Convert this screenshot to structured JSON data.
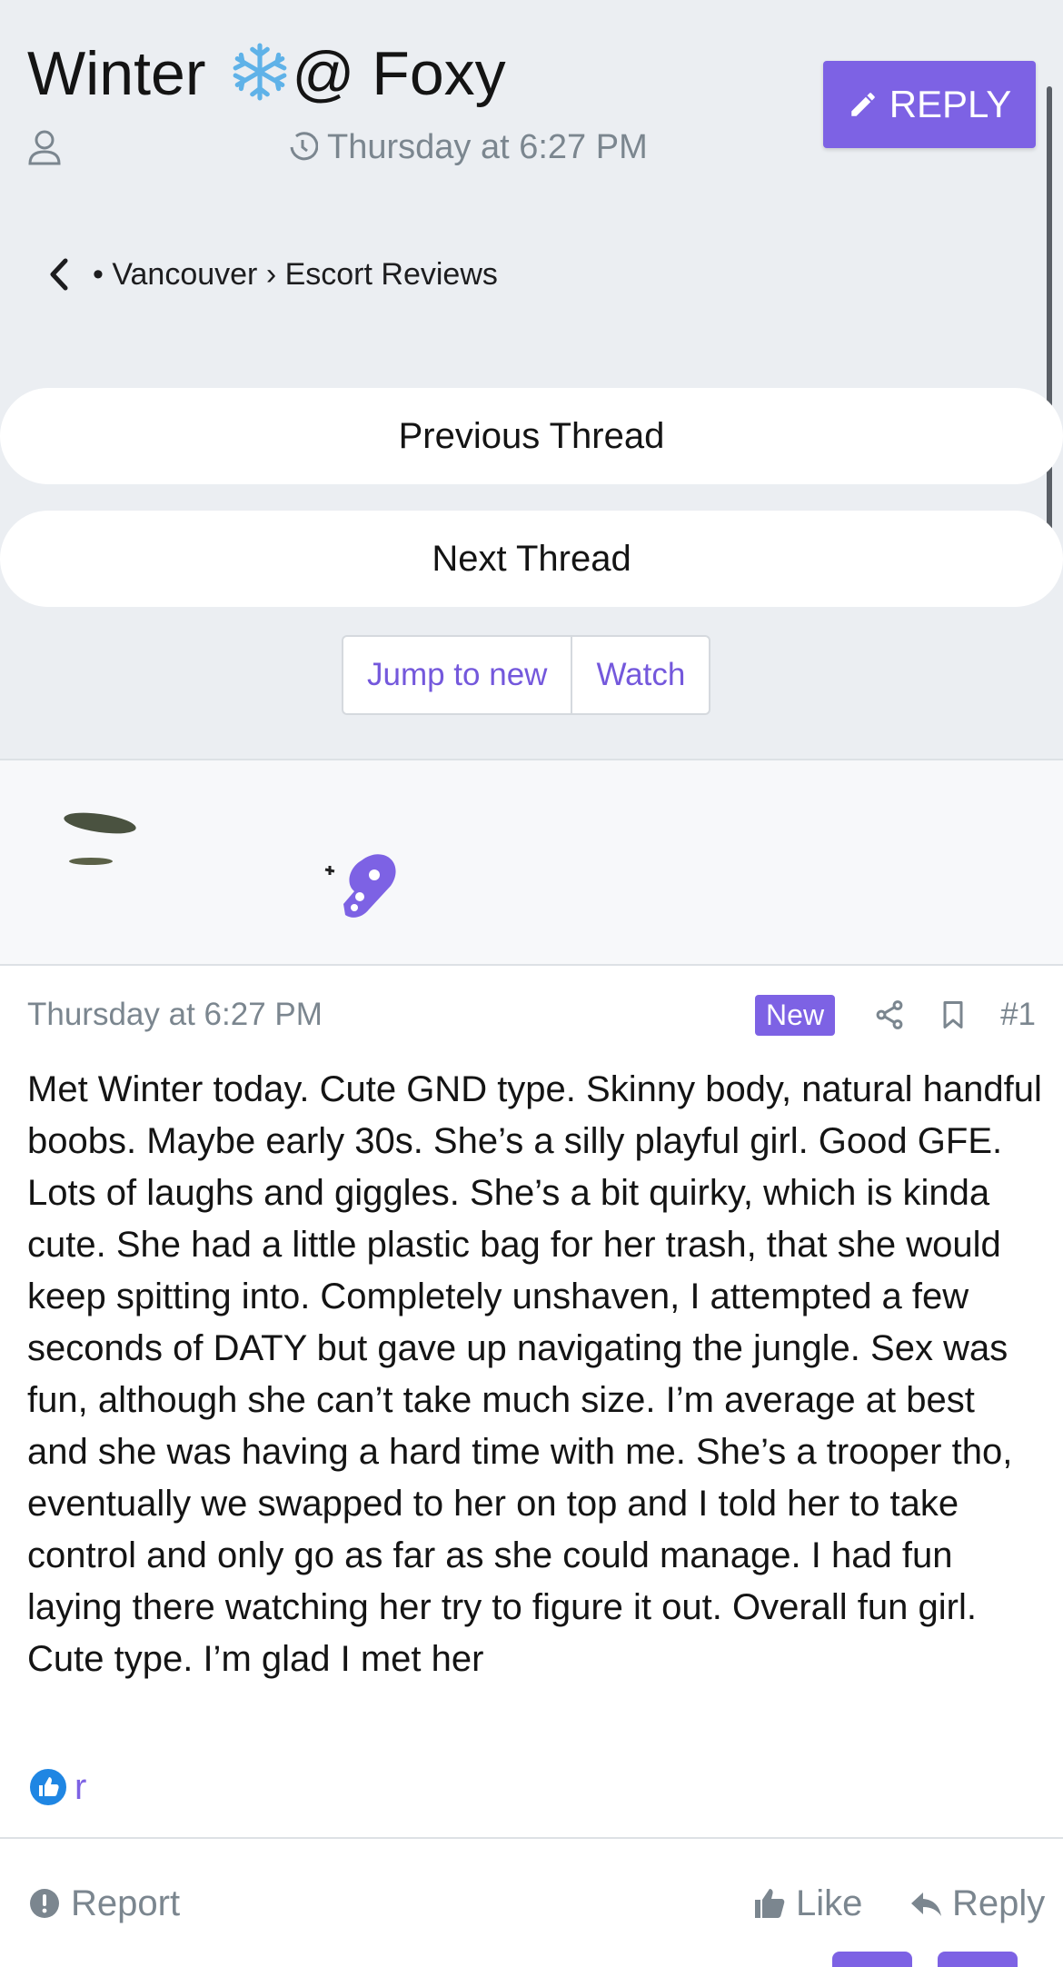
{
  "thread": {
    "title_before": "Winter ",
    "title_after": "@ Foxy",
    "timestamp": "Thursday at 6:27 PM"
  },
  "header": {
    "reply_label": "REPLY"
  },
  "breadcrumb": {
    "path": "• Vancouver › Escort Reviews"
  },
  "nav": {
    "previous_label": "Previous Thread",
    "next_label": "Next Thread"
  },
  "actions": {
    "jump_label": "Jump to new",
    "watch_label": "Watch"
  },
  "post": {
    "date": "Thursday at 6:27 PM",
    "new_badge": "New",
    "number": "#1",
    "body": "Met Winter today. Cute GND type. Skinny body, natural handful boobs. Maybe early 30s. She’s a silly playful girl. Good GFE. Lots of laughs and giggles. She’s a bit quirky, which is kinda cute. She had a little plastic bag for her trash, that she would keep spitting into. Completely unshaven, I attempted a few seconds of DATY but gave up navigating the jungle. Sex was fun, although she can’t take much size. I’m average at best and she was having a hard time with me. She’s a trooper tho, eventually we swapped to her on top and I told her to take control and only go as far as she could manage. I had fun laying there watching her try to figure it out. Overall fun girl. Cute type. I’m glad I met her",
    "reaction_user": "r"
  },
  "footer": {
    "report_label": "Report",
    "like_label": "Like",
    "reply_label": "Reply"
  },
  "colors": {
    "accent": "#7d62e4",
    "header_bg": "#ebeef2",
    "muted": "#7b868f"
  },
  "icons": [
    "user-icon",
    "clock-icon",
    "pencil-icon",
    "chevron-left-icon",
    "snowflake-icon",
    "share-icon",
    "bookmark-icon",
    "thumbs-up-icon",
    "alert-icon",
    "reply-arrow-icon"
  ]
}
